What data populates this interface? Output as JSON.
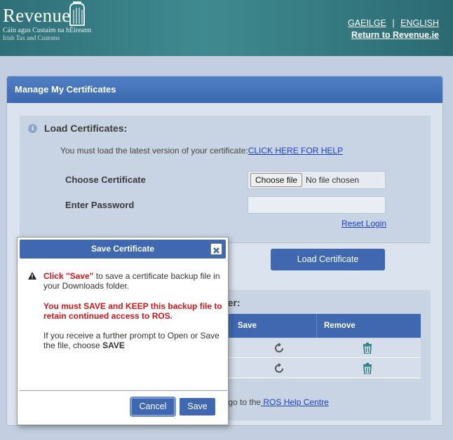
{
  "header": {
    "logo_word": "Revenue",
    "logo_sub1": "Cáin agus Custaim na hÉireann",
    "logo_sub2": "Irish Tax and Customs",
    "lang_irish": "GAEILGE",
    "lang_separator": "|",
    "lang_english": "ENGLISH",
    "return_link": "Return to Revenue.ie"
  },
  "panel": {
    "title": "Manage My Certificates",
    "load_section": {
      "info_icon": "i",
      "title": "Load Certificates:",
      "note": "You must load the latest version of your certificate:",
      "help_link": "CLICK HERE FOR HELP",
      "choose_label": "Choose Certificate",
      "file_button": "Choose file",
      "file_status": "No file chosen",
      "password_label": "Enter Password",
      "password_value": "",
      "reset_link": "Reset Login",
      "load_button": "Load Certificate"
    },
    "browser_section": {
      "title_partial": "wser:",
      "columns": [
        "Save",
        "Remove"
      ],
      "rows": [
        {
          "save_icon": "refresh-icon",
          "remove_icon": "trash-icon"
        },
        {
          "save_icon": "refresh-icon",
          "remove_icon": "trash-icon"
        }
      ],
      "help_prefix": "r go to the",
      "help_link": " ROS Help Centre"
    }
  },
  "modal": {
    "title": "Save Certificate",
    "line1_red": "Click \"Save\"",
    "line1_rest": " to save a certificate backup file in your Downloads folder.",
    "warning_red": "You must SAVE and KEEP this backup file to retain continued access to ROS.",
    "line3_prefix": "If you receive a further prompt to Open or Save the file, choose ",
    "line3_bold": "SAVE",
    "cancel": "Cancel",
    "save": "Save"
  },
  "colors": {
    "header_teal": "#3f8a90",
    "primary_blue": "#3f68b0",
    "link_blue": "#1a3fc4",
    "warning_red": "#d0141a"
  }
}
